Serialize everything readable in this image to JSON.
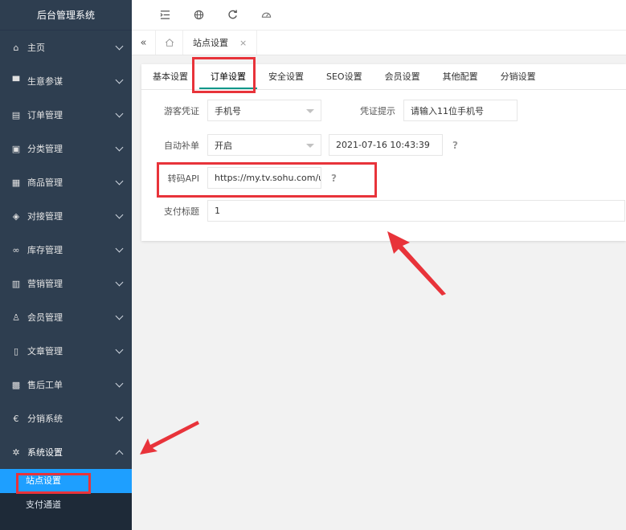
{
  "app": {
    "title": "后台管理系统"
  },
  "sidebar": {
    "items": [
      {
        "label": "主页",
        "icon": "home-icon",
        "glyph": "⌂"
      },
      {
        "label": "生意参谋",
        "icon": "monitor-icon",
        "glyph": "▀"
      },
      {
        "label": "订单管理",
        "icon": "clipboard-icon",
        "glyph": "▤"
      },
      {
        "label": "分类管理",
        "icon": "category-icon",
        "glyph": "▣"
      },
      {
        "label": "商品管理",
        "icon": "goods-icon",
        "glyph": "▦"
      },
      {
        "label": "对接管理",
        "icon": "shield-icon",
        "glyph": "◈"
      },
      {
        "label": "库存管理",
        "icon": "infinity-icon",
        "glyph": "∞"
      },
      {
        "label": "营销管理",
        "icon": "gift-icon",
        "glyph": "▥"
      },
      {
        "label": "会员管理",
        "icon": "user-icon",
        "glyph": "♙"
      },
      {
        "label": "文章管理",
        "icon": "document-icon",
        "glyph": "▯"
      },
      {
        "label": "售后工单",
        "icon": "calendar-icon",
        "glyph": "▩"
      },
      {
        "label": "分销系统",
        "icon": "euro-icon",
        "glyph": "€"
      },
      {
        "label": "系统设置",
        "icon": "gear-icon",
        "glyph": "✲"
      }
    ],
    "submenu": [
      {
        "label": "站点设置"
      },
      {
        "label": "支付通道"
      },
      {
        "label": ""
      }
    ]
  },
  "tabsbar": {
    "active_tab": "站点设置",
    "close_glyph": "×",
    "collapse_glyph": "«"
  },
  "card": {
    "tabs": [
      {
        "label": "基本设置"
      },
      {
        "label": "订单设置"
      },
      {
        "label": "安全设置"
      },
      {
        "label": "SEO设置"
      },
      {
        "label": "会员设置"
      },
      {
        "label": "其他配置"
      },
      {
        "label": "分销设置"
      }
    ],
    "active_tab_index": 1
  },
  "form": {
    "guest_voucher": {
      "label": "游客凭证",
      "value": "手机号"
    },
    "voucher_hint": {
      "label": "凭证提示",
      "value": "请输入11位手机号"
    },
    "auto_refill": {
      "label": "自动补单",
      "value": "开启",
      "time": "2021-07-16 10:43:39",
      "help": "?"
    },
    "shorturl_api": {
      "label": "转码API",
      "value": "https://my.tv.sohu.com/user/a",
      "help": "?"
    },
    "pay_title": {
      "label": "支付标题",
      "value": "1"
    }
  },
  "colors": {
    "sidebar_bg": "#2e3e50",
    "active_blue": "#1e9fff",
    "highlight_red": "#e8333a"
  }
}
